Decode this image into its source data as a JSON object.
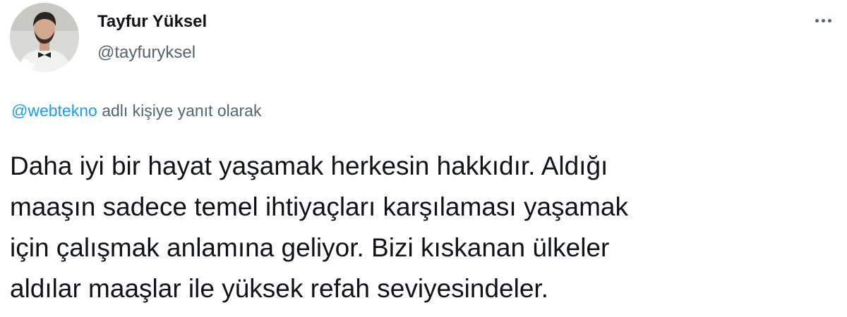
{
  "author": {
    "display_name": "Tayfur Yüksel",
    "handle": "@tayfuryksel",
    "avatar_icon": "profile-photo"
  },
  "menu": {
    "icon": "more-horizontal-icon"
  },
  "reply_context": {
    "mention": "@webtekno",
    "suffix": " adlı kişiye yanıt olarak"
  },
  "tweet": {
    "text": "Daha iyi bir hayat yaşamak herkesin hakkıdır. Aldığı\nmaaşın sadece temel ihtiyaçları karşılaması  yaşamak\niçin çalışmak anlamına geliyor. Bizi kıskanan ülkeler\naldılar maaşlar ile yüksek refah seviyesindeler."
  },
  "colors": {
    "text_primary": "#0f1419",
    "text_secondary": "#536471",
    "link": "#1d9bf0",
    "background": "#ffffff"
  }
}
